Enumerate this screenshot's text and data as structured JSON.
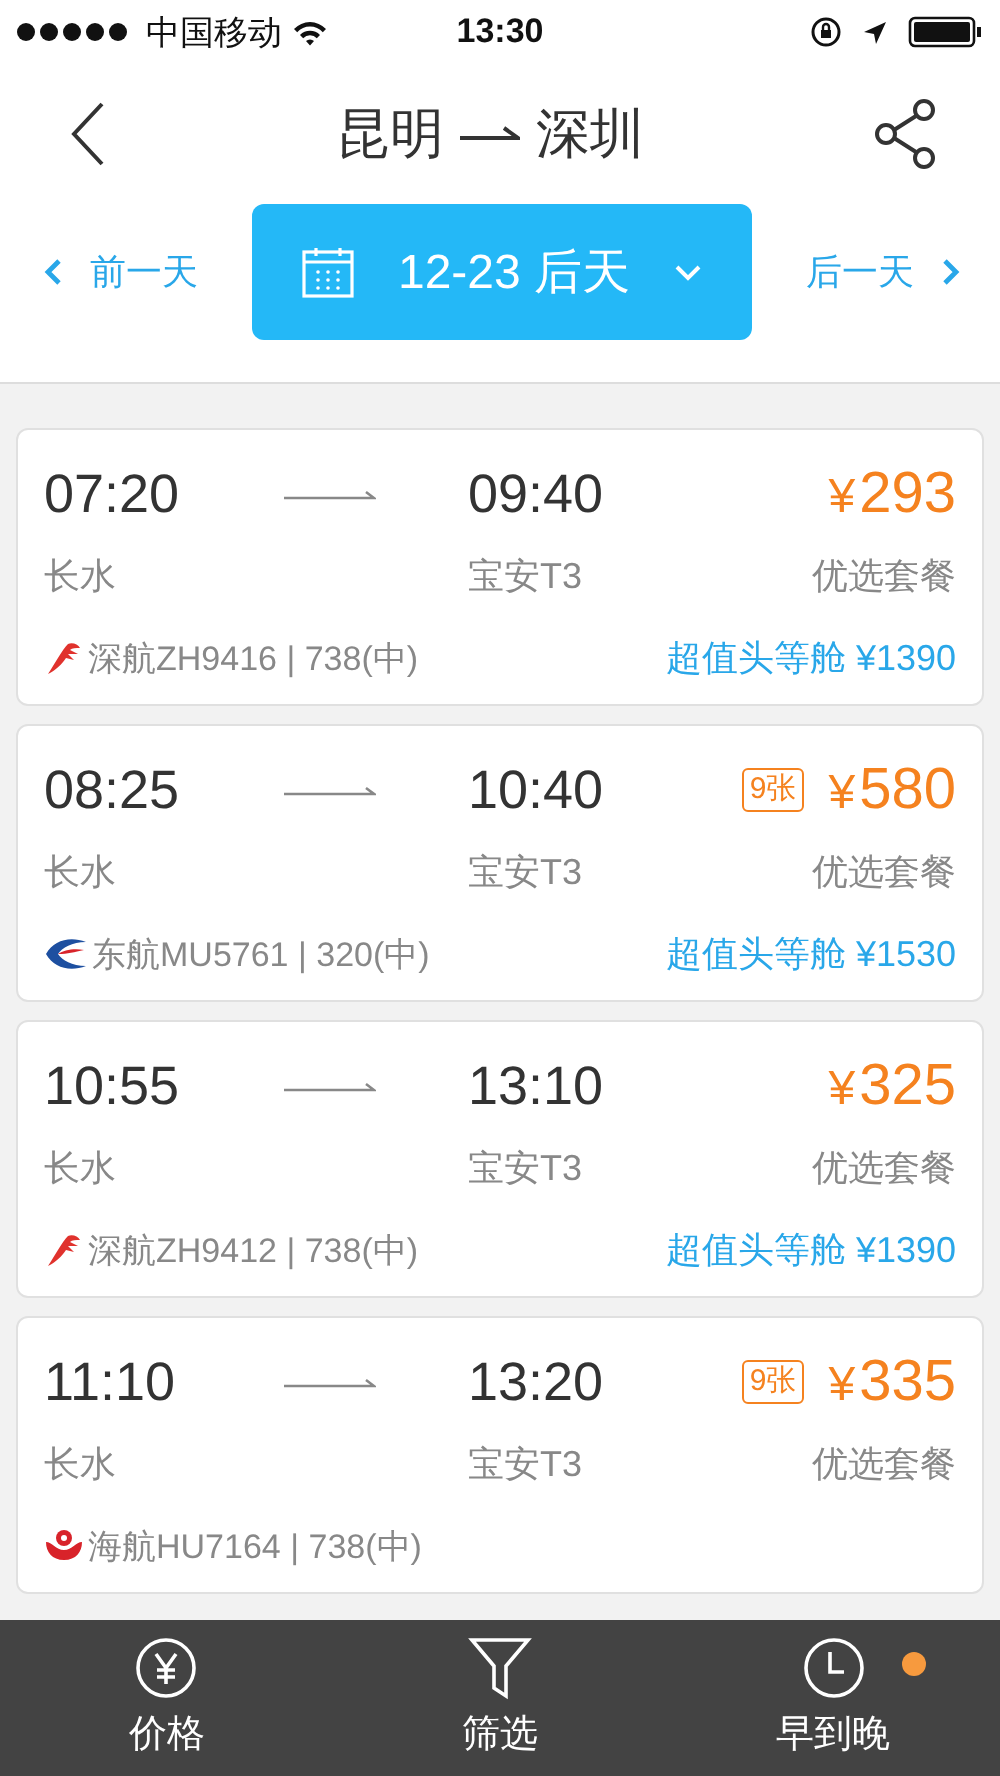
{
  "status_bar": {
    "carrier": "中国移动",
    "time": "13:30"
  },
  "header": {
    "from": "昆明",
    "to": "深圳"
  },
  "date_nav": {
    "prev": "前一天",
    "current": "12-23 后天",
    "next": "后一天"
  },
  "flights": [
    {
      "depart": "07:20",
      "arrive": "09:40",
      "from": "长水",
      "to": "宝安T3",
      "currency": "¥",
      "price": "293",
      "cabin": "优选套餐",
      "kind": "shenzhen",
      "flight": "深航ZH9416 | 738(中)",
      "offer": "超值头等舱 ¥1390"
    },
    {
      "depart": "08:25",
      "arrive": "10:40",
      "from": "长水",
      "to": "宝安T3",
      "tickets": "9张",
      "currency": "¥",
      "price": "580",
      "cabin": "优选套餐",
      "kind": "eastern",
      "flight": "东航MU5761 | 320(中)",
      "offer": "超值头等舱 ¥1530"
    },
    {
      "depart": "10:55",
      "arrive": "13:10",
      "from": "长水",
      "to": "宝安T3",
      "currency": "¥",
      "price": "325",
      "cabin": "优选套餐",
      "kind": "shenzhen",
      "flight": "深航ZH9412 | 738(中)",
      "offer": "超值头等舱 ¥1390"
    },
    {
      "depart": "11:10",
      "arrive": "13:20",
      "from": "长水",
      "to": "宝安T3",
      "tickets": "9张",
      "currency": "¥",
      "price": "335",
      "cabin": "优选套餐",
      "kind": "hainan",
      "flight": "海航HU7164 | 738(中)"
    }
  ],
  "bottom_bar": [
    {
      "label": "价格",
      "kind": "price",
      "selected": false
    },
    {
      "label": "筛选",
      "kind": "filter",
      "selected": false
    },
    {
      "label": "早到晚",
      "kind": "time",
      "selected": true
    }
  ]
}
